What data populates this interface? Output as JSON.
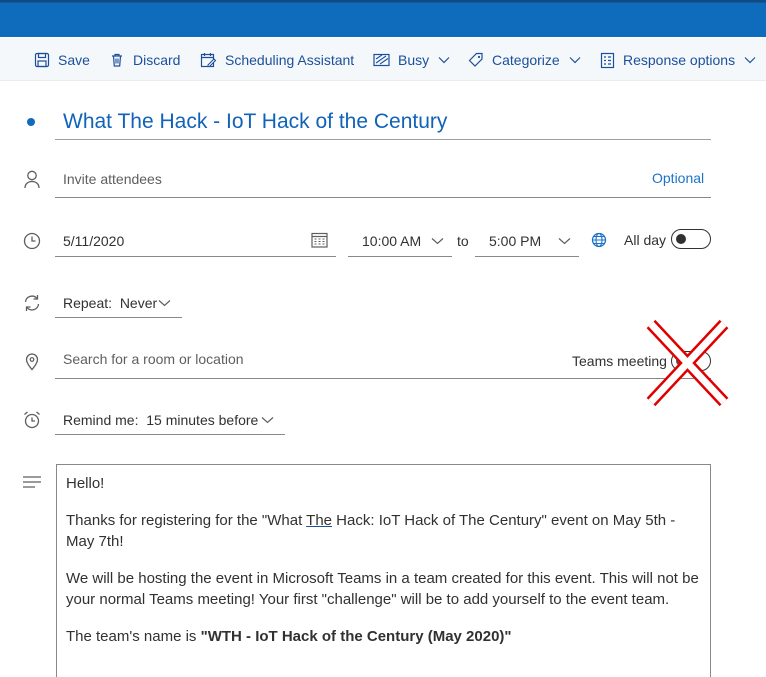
{
  "toolbar": {
    "save": "Save",
    "discard": "Discard",
    "scheduling_assistant": "Scheduling Assistant",
    "busy": "Busy",
    "categorize": "Categorize",
    "response_options": "Response options"
  },
  "event": {
    "title": "What The Hack - IoT Hack of the Century",
    "attendees_placeholder": "Invite attendees",
    "optional_link": "Optional",
    "date": "5/11/2020",
    "start_time": "10:00 AM",
    "to_label": "to",
    "end_time": "5:00 PM",
    "all_day_label": "All day",
    "all_day_on": false,
    "repeat": "Repeat:  Never",
    "location_placeholder": "Search for a room or location",
    "teams_meeting_label": "Teams meeting",
    "teams_meeting_on": false,
    "reminder": "Remind me:  15 minutes before"
  },
  "body": {
    "p1": "Hello!",
    "p2_before": "Thanks for registering for the \"What ",
    "p2_underlined": "The",
    "p2_after": " Hack: IoT Hack of The Century\" event on May 5th - May 7th!",
    "p3": "We will be hosting the event in Microsoft Teams in a team created for this event. This will not be your normal Teams meeting! Your first \"challenge\" will be to add yourself to the event team.",
    "p4_before": "The team's name is ",
    "p4_bold": "\"WTH - IoT Hack of the Century (May 2020)\""
  },
  "colors": {
    "accent": "#0f6cbd",
    "link": "#1b73c7",
    "annotation_red": "#e00000"
  }
}
